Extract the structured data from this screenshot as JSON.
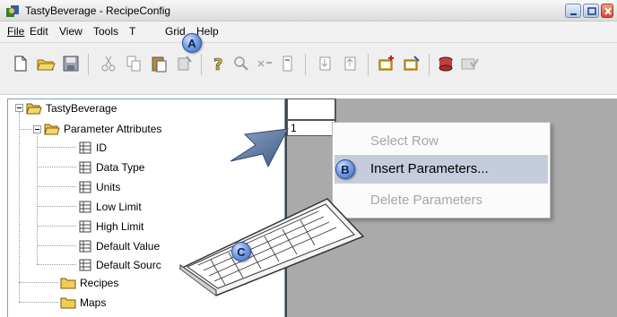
{
  "window": {
    "title": "TastyBeverage - RecipeConfig"
  },
  "menubar": {
    "items": [
      "File",
      "Edit",
      "View",
      "Tools",
      "T",
      "Grid",
      "Help"
    ]
  },
  "tree": {
    "root": "TastyBeverage",
    "parameter_attributes": "Parameter Attributes",
    "attributes": [
      "ID",
      "Data Type",
      "Units",
      "Low Limit",
      "High Limit",
      "Default Value",
      "Default Sourc"
    ],
    "recipes": "Recipes",
    "maps": "Maps"
  },
  "grid": {
    "row1_value": "1"
  },
  "context_menu": {
    "items": [
      {
        "label": "Select Row",
        "enabled": false
      },
      {
        "label": "Insert Parameters...",
        "enabled": true,
        "highlighted": true
      },
      {
        "label": "Delete Parameters",
        "enabled": false
      }
    ]
  },
  "callouts": {
    "a": "A",
    "b": "B",
    "c": "C"
  },
  "colors": {
    "menu_highlight": "#c5cddd",
    "grid_background": "#aaaaaa",
    "badge_blue": "#7b9fe0"
  }
}
